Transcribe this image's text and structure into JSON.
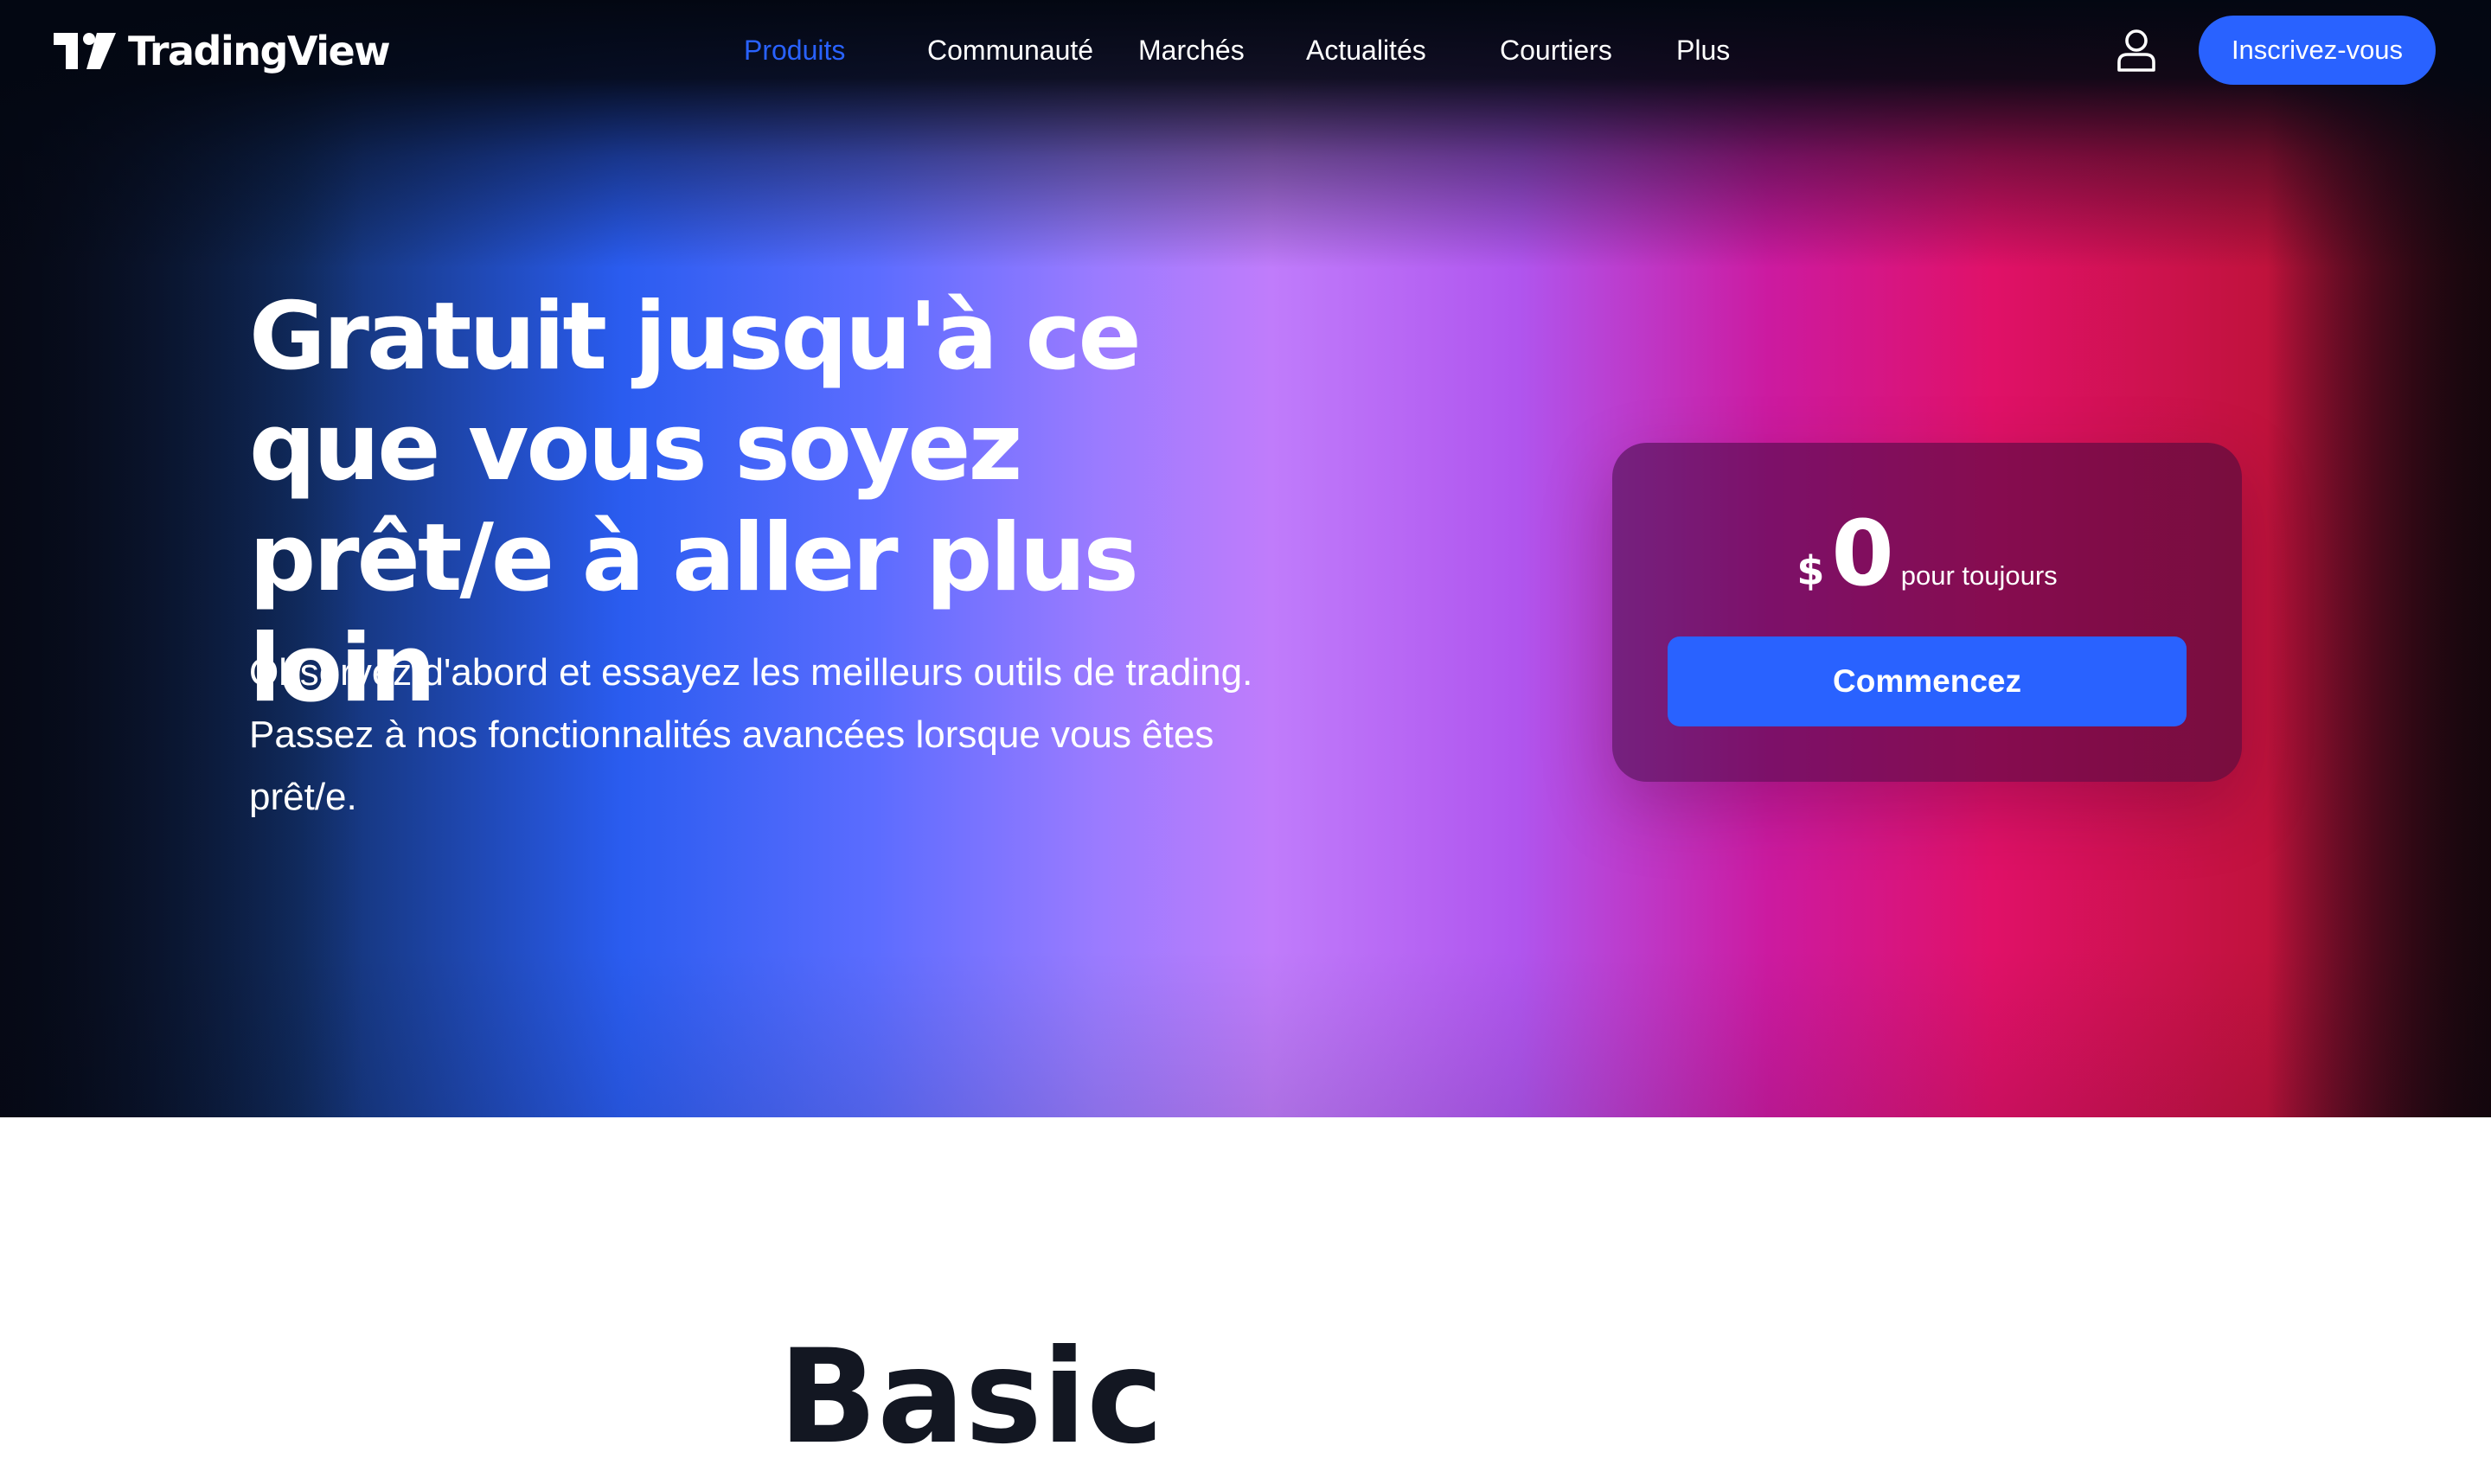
{
  "brand": {
    "name": "TradingView",
    "logo_icon": "tradingview-logo-icon"
  },
  "nav": {
    "items": [
      {
        "label": "Produits",
        "active": true
      },
      {
        "label": "Communauté",
        "active": false
      },
      {
        "label": "Marchés",
        "active": false
      },
      {
        "label": "Actualités",
        "active": false
      },
      {
        "label": "Courtiers",
        "active": false
      },
      {
        "label": "Plus",
        "active": false
      }
    ],
    "user_icon": "user-icon",
    "signup_label": "Inscrivez-vous"
  },
  "hero": {
    "title": "Gratuit jusqu'à ce que vous soyez prêt/e à aller plus loin",
    "subtitle_line1": "Observez d'abord et essayez les meilleurs outils de trading.",
    "subtitle_line2": "Passez à nos fonctionnalités avancées lorsque vous êtes prêt/e."
  },
  "pricing": {
    "currency": "$",
    "amount": "0",
    "period": "pour toujours",
    "cta_label": "Commencez"
  },
  "section": {
    "heading": "Basic"
  },
  "colors": {
    "accent": "#2962ff",
    "text_light": "#ffffff",
    "text_dark": "#131722",
    "header_bg": "#030712"
  }
}
